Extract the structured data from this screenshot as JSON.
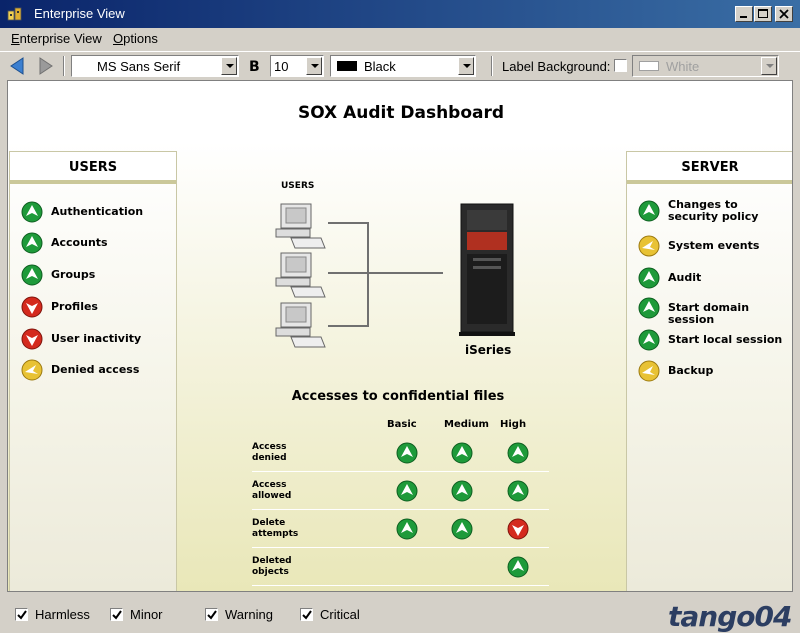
{
  "window": {
    "title": "Enterprise View"
  },
  "menu": {
    "items": [
      "Enterprise View",
      "Options"
    ]
  },
  "toolbar": {
    "font": "MS Sans Serif",
    "bold_label": "B",
    "size": "10",
    "color": "Black",
    "label_background": "Label Background:",
    "bg_color": "White"
  },
  "dashboard": {
    "title": "SOX Audit Dashboard",
    "users_panel": {
      "title": "USERS",
      "items": [
        {
          "label": "Authentication",
          "status": "green"
        },
        {
          "label": "Accounts",
          "status": "green"
        },
        {
          "label": "Groups",
          "status": "green"
        },
        {
          "label": "Profiles",
          "status": "red"
        },
        {
          "label": "User inactivity",
          "status": "red"
        },
        {
          "label": "Denied access",
          "status": "yellow"
        }
      ]
    },
    "server_panel": {
      "title": "SERVER",
      "items": [
        {
          "label": "Changes to security policy",
          "status": "green"
        },
        {
          "label": "System events",
          "status": "yellow"
        },
        {
          "label": "Audit",
          "status": "green"
        },
        {
          "label": "Start domain session",
          "status": "green"
        },
        {
          "label": "Start local session",
          "status": "green"
        },
        {
          "label": "Backup",
          "status": "yellow"
        }
      ]
    },
    "diagram": {
      "users_label": "USERS",
      "server_label": "iSeries"
    },
    "access": {
      "title": "Accesses to confidential files",
      "columns": [
        "Basic",
        "Medium",
        "High"
      ],
      "rows": [
        {
          "name": "Access denied",
          "cells": [
            "green",
            "green",
            "green"
          ]
        },
        {
          "name": "Access allowed",
          "cells": [
            "green",
            "green",
            "green"
          ]
        },
        {
          "name": "Delete attempts",
          "cells": [
            "green",
            "green",
            "red"
          ]
        },
        {
          "name": "Deleted objects",
          "cells": [
            "",
            "",
            "green"
          ]
        }
      ]
    }
  },
  "statusbar": {
    "filters": [
      {
        "label": "Harmless",
        "checked": true
      },
      {
        "label": "Minor",
        "checked": true
      },
      {
        "label": "Warning",
        "checked": true
      },
      {
        "label": "Critical",
        "checked": true
      }
    ],
    "logo": "tango04"
  },
  "colors": {
    "green": "#1e9a3a",
    "red": "#d42a1e",
    "yellow": "#e8c234"
  }
}
